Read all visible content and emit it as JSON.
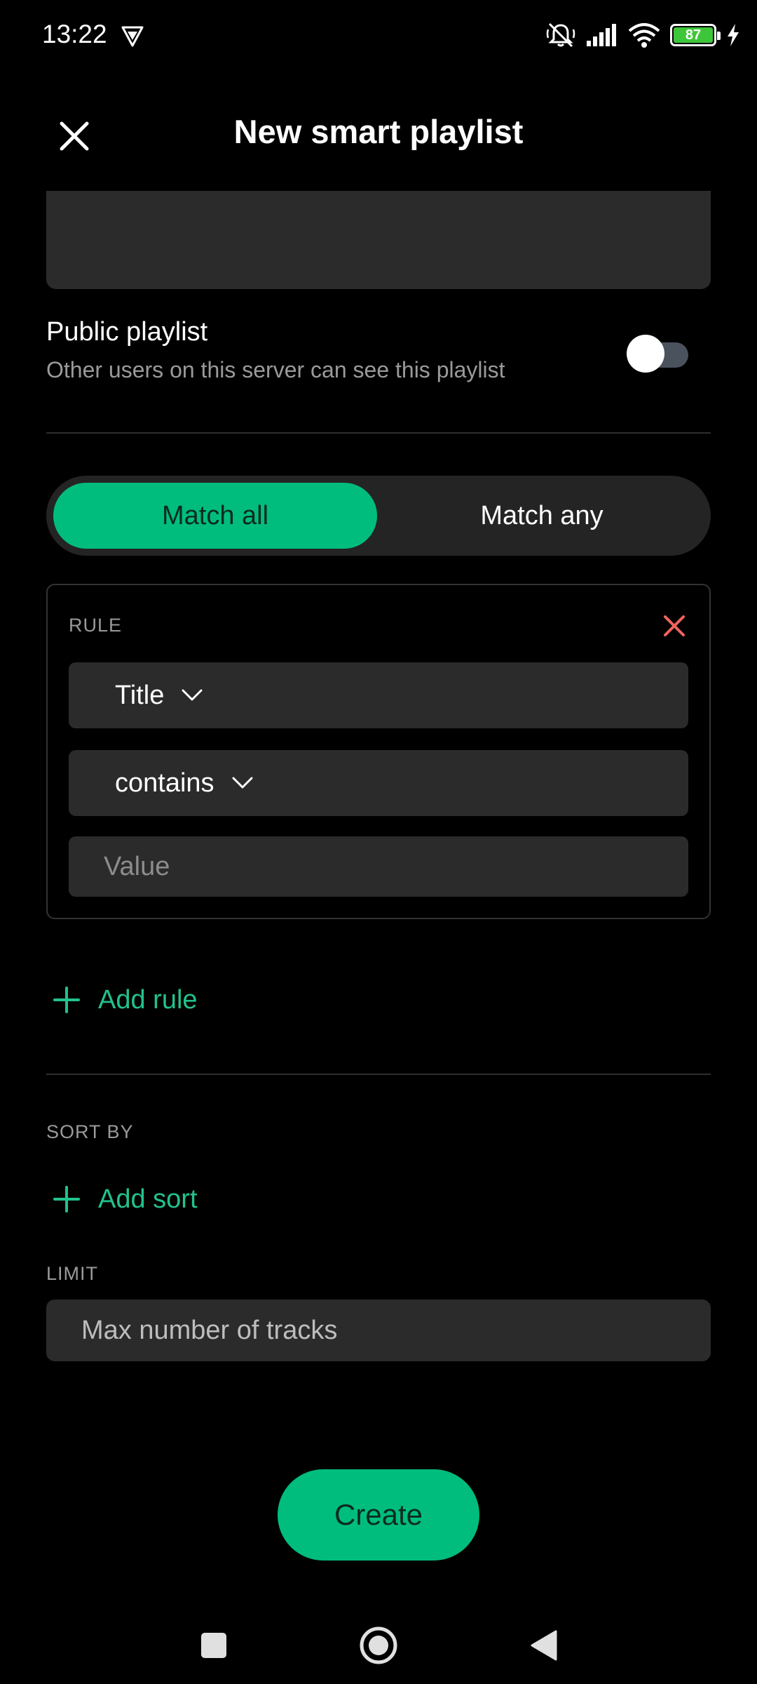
{
  "status_bar": {
    "time": "13:22",
    "battery_level": "87",
    "icons": [
      "vpn-icon",
      "mute-icon",
      "signal-icon",
      "wifi-icon",
      "battery-icon",
      "charging-icon"
    ]
  },
  "header": {
    "title": "New smart playlist",
    "close_icon": "close-icon"
  },
  "public_playlist": {
    "title": "Public playlist",
    "subtitle": "Other users on this server can see this playlist",
    "enabled": false
  },
  "match_mode": {
    "options": [
      "Match all",
      "Match any"
    ],
    "selected": "Match all"
  },
  "rule": {
    "label": "RULE",
    "field": "Title",
    "operator": "contains",
    "value_placeholder": "Value",
    "value": ""
  },
  "add_rule_label": "Add rule",
  "sort": {
    "label": "SORT BY",
    "add_label": "Add sort"
  },
  "limit": {
    "label": "LIMIT",
    "placeholder": "Max number of tracks",
    "value": ""
  },
  "create_label": "Create",
  "colors": {
    "accent": "#00bd7e",
    "accent_text": "#22c28a",
    "remove": "#f0645c",
    "background": "#000000",
    "surface": "#2b2b2b"
  }
}
